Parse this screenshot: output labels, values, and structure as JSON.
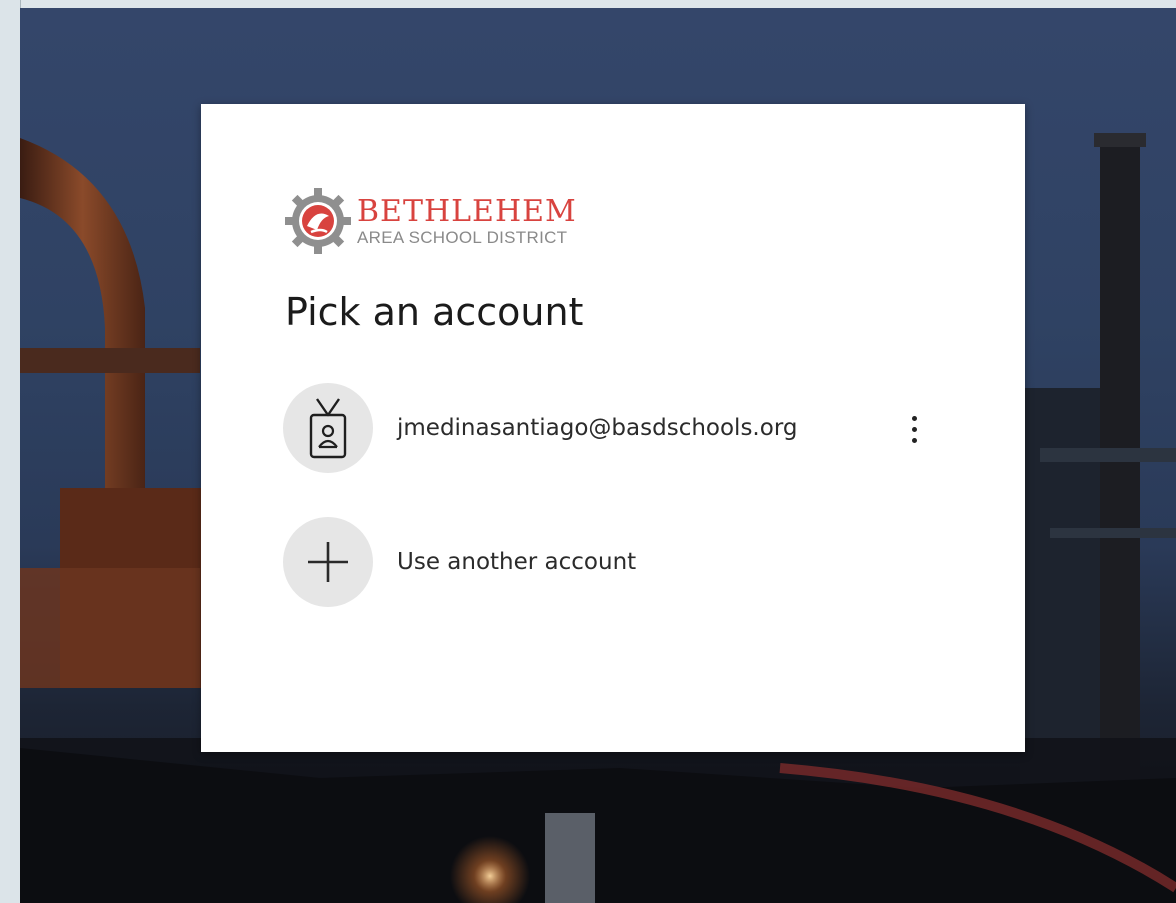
{
  "organization": {
    "name": "BETHLEHEM",
    "subtitle": "AREA SCHOOL DISTRICT"
  },
  "dialog": {
    "title": "Pick an account",
    "accounts": [
      {
        "email": "jmedinasantiago@basdschools.org",
        "icon": "id-badge-icon"
      }
    ],
    "other_account_label": "Use another account",
    "more_options_icon": "more-vertical-icon"
  },
  "colors": {
    "brand_red": "#d8433f",
    "brand_gray": "#8a8a8a",
    "avatar_bg": "#e6e6e6"
  }
}
